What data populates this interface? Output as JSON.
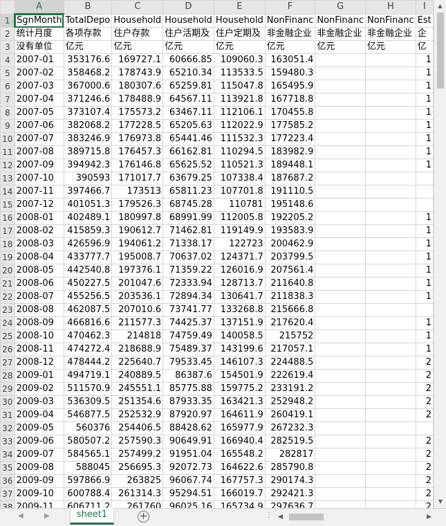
{
  "sheet": {
    "columns": [
      "A",
      "B",
      "C",
      "D",
      "E",
      "F",
      "G",
      "H",
      "I"
    ],
    "selected_column": "A",
    "selected_row": 1,
    "rows": [
      {
        "n": "1",
        "cells": [
          "SgnMonth",
          "TotalDepo",
          "Household",
          "Household",
          "Household",
          "NonFinanc",
          "NonFinanc",
          "NonFinanc",
          "Est"
        ]
      },
      {
        "n": "2",
        "cells": [
          "统计月度",
          "各项存款",
          "住户存款",
          "住户活期及",
          "住户定期及",
          "非金融企业",
          "非金融企业",
          "非金融企业",
          "企"
        ]
      },
      {
        "n": "3",
        "cells": [
          "没有单位",
          "亿元",
          "亿元",
          "亿元",
          "亿元",
          "亿元",
          "亿元",
          "亿元",
          "亿"
        ]
      },
      {
        "n": "4",
        "cells": [
          "2007-01",
          "353176.6",
          "169727.1",
          "60666.85",
          "109060.3",
          "163051.4",
          "",
          "",
          "1"
        ]
      },
      {
        "n": "5",
        "cells": [
          "2007-02",
          "358468.2",
          "178743.9",
          "65210.34",
          "113533.5",
          "159480.3",
          "",
          "",
          "1"
        ]
      },
      {
        "n": "6",
        "cells": [
          "2007-03",
          "367000.6",
          "180307.6",
          "65259.81",
          "115047.8",
          "165495.9",
          "",
          "",
          "1"
        ]
      },
      {
        "n": "7",
        "cells": [
          "2007-04",
          "371246.6",
          "178488.9",
          "64567.11",
          "113921.8",
          "167718.8",
          "",
          "",
          "1"
        ]
      },
      {
        "n": "8",
        "cells": [
          "2007-05",
          "373107.4",
          "175573.2",
          "63467.11",
          "112106.1",
          "170455.8",
          "",
          "",
          "1"
        ]
      },
      {
        "n": "9",
        "cells": [
          "2007-06",
          "382068.2",
          "177228.5",
          "65205.63",
          "112022.9",
          "177585.2",
          "",
          "",
          "1"
        ]
      },
      {
        "n": "10",
        "cells": [
          "2007-07",
          "383246.9",
          "176973.8",
          "65441.46",
          "111532.3",
          "177223.4",
          "",
          "",
          "1"
        ]
      },
      {
        "n": "11",
        "cells": [
          "2007-08",
          "389715.8",
          "176457.3",
          "66162.81",
          "110294.5",
          "183982.9",
          "",
          "",
          "1"
        ]
      },
      {
        "n": "12",
        "cells": [
          "2007-09",
          "394942.3",
          "176146.8",
          "65625.52",
          "110521.3",
          "189448.1",
          "",
          "",
          "1"
        ]
      },
      {
        "n": "13",
        "cells": [
          "2007-10",
          "390593",
          "171017.7",
          "63679.25",
          "107338.4",
          "187687.2",
          "",
          "",
          ""
        ]
      },
      {
        "n": "14",
        "cells": [
          "2007-11",
          "397466.7",
          "173513",
          "65811.23",
          "107701.8",
          "191110.5",
          "",
          "",
          ""
        ]
      },
      {
        "n": "15",
        "cells": [
          "2007-12",
          "401051.3",
          "179526.3",
          "68745.28",
          "110781",
          "195148.6",
          "",
          "",
          ""
        ]
      },
      {
        "n": "16",
        "cells": [
          "2008-01",
          "402489.1",
          "180997.8",
          "68991.99",
          "112005.8",
          "192205.2",
          "",
          "",
          "1"
        ]
      },
      {
        "n": "17",
        "cells": [
          "2008-02",
          "415859.3",
          "190612.7",
          "71462.81",
          "119149.9",
          "193583.9",
          "",
          "",
          "1"
        ]
      },
      {
        "n": "18",
        "cells": [
          "2008-03",
          "426596.9",
          "194061.2",
          "71338.17",
          "122723",
          "200462.9",
          "",
          "",
          "1"
        ]
      },
      {
        "n": "19",
        "cells": [
          "2008-04",
          "433777.7",
          "195008.7",
          "70637.02",
          "124371.7",
          "203799.5",
          "",
          "",
          "1"
        ]
      },
      {
        "n": "20",
        "cells": [
          "2008-05",
          "442540.8",
          "197376.1",
          "71359.22",
          "126016.9",
          "207561.4",
          "",
          "",
          "1"
        ]
      },
      {
        "n": "21",
        "cells": [
          "2008-06",
          "450227.5",
          "201047.6",
          "72333.94",
          "128713.7",
          "211640.8",
          "",
          "",
          "1"
        ]
      },
      {
        "n": "22",
        "cells": [
          "2008-07",
          "455256.5",
          "203536.1",
          "72894.34",
          "130641.7",
          "211838.3",
          "",
          "",
          "1"
        ]
      },
      {
        "n": "23",
        "cells": [
          "2008-08",
          "462087.5",
          "207010.6",
          "73741.77",
          "133268.8",
          "215666.8",
          "",
          "",
          ""
        ]
      },
      {
        "n": "24",
        "cells": [
          "2008-09",
          "466816.6",
          "211577.3",
          "74425.37",
          "137151.9",
          "217620.4",
          "",
          "",
          "1"
        ]
      },
      {
        "n": "25",
        "cells": [
          "2008-10",
          "470462.3",
          "214818",
          "74759.49",
          "140058.5",
          "215752",
          "",
          "",
          "1"
        ]
      },
      {
        "n": "26",
        "cells": [
          "2008-11",
          "474272.4",
          "218688.9",
          "75489.37",
          "143199.6",
          "217057.1",
          "",
          "",
          "1"
        ]
      },
      {
        "n": "27",
        "cells": [
          "2008-12",
          "478444.2",
          "225640.7",
          "79533.45",
          "146107.3",
          "224488.5",
          "",
          "",
          "2"
        ]
      },
      {
        "n": "28",
        "cells": [
          "2009-01",
          "494719.1",
          "240889.5",
          "86387.6",
          "154501.9",
          "222619.4",
          "",
          "",
          "2"
        ]
      },
      {
        "n": "29",
        "cells": [
          "2009-02",
          "511570.9",
          "245551.1",
          "85775.88",
          "159775.2",
          "233191.2",
          "",
          "",
          "2"
        ]
      },
      {
        "n": "30",
        "cells": [
          "2009-03",
          "536309.5",
          "251354.6",
          "87933.35",
          "163421.3",
          "252948.2",
          "",
          "",
          "2"
        ]
      },
      {
        "n": "31",
        "cells": [
          "2009-04",
          "546877.5",
          "252532.9",
          "87920.97",
          "164611.9",
          "260419.1",
          "",
          "",
          "2"
        ]
      },
      {
        "n": "32",
        "cells": [
          "2009-05",
          "560376",
          "254406.5",
          "88428.62",
          "165977.9",
          "267232.3",
          "",
          "",
          ""
        ]
      },
      {
        "n": "33",
        "cells": [
          "2009-06",
          "580507.2",
          "257590.3",
          "90649.91",
          "166940.4",
          "282519.5",
          "",
          "",
          "2"
        ]
      },
      {
        "n": "34",
        "cells": [
          "2009-07",
          "584565.1",
          "257499.2",
          "91951.04",
          "165548.2",
          "282817",
          "",
          "",
          "2"
        ]
      },
      {
        "n": "35",
        "cells": [
          "2009-08",
          "588045",
          "256695.3",
          "92072.73",
          "164622.6",
          "285790.8",
          "",
          "",
          "2"
        ]
      },
      {
        "n": "36",
        "cells": [
          "2009-09",
          "597866.9",
          "263825",
          "96067.74",
          "167757.3",
          "290174.3",
          "",
          "",
          "2"
        ]
      },
      {
        "n": "37",
        "cells": [
          "2009-10",
          "600788.4",
          "261314.3",
          "95294.51",
          "166019.7",
          "292421.3",
          "",
          "",
          "2"
        ]
      },
      {
        "n": "38",
        "cells": [
          "2009-11",
          "606711.2",
          "261760",
          "96025.16",
          "165734.9",
          "297636.7",
          "",
          "",
          "2"
        ]
      }
    ]
  },
  "tabs": {
    "active_sheet": "sheet1",
    "add_sheet": "+",
    "more": "⋮"
  },
  "icons": {
    "vscroll_up": "▲",
    "vscroll_down": "▼",
    "nav_prev": "◀",
    "nav_next": "▶",
    "hscroll_left": "◀",
    "hscroll_right": "▶"
  },
  "colors": {
    "accent": "#217346",
    "header_bg": "#e6e6e6",
    "grid_line": "#d4d4d4"
  }
}
